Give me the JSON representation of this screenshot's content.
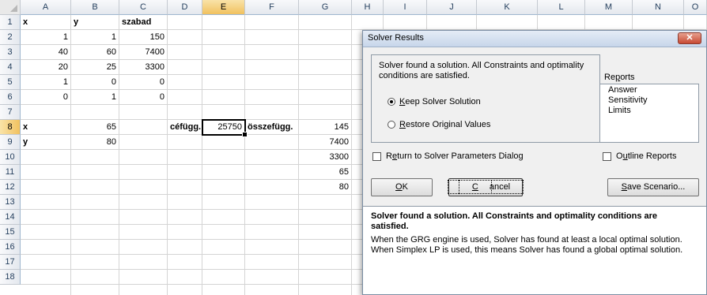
{
  "sheet": {
    "columns": [
      "A",
      "B",
      "C",
      "D",
      "E",
      "F",
      "G",
      "H",
      "I",
      "J",
      "K",
      "L",
      "M",
      "N",
      "O"
    ],
    "rows": [
      "1",
      "2",
      "3",
      "4",
      "5",
      "6",
      "7",
      "8",
      "9",
      "10",
      "11",
      "12",
      "13",
      "14",
      "15",
      "16",
      "17",
      "18"
    ],
    "selected_column": "E",
    "selected_row": "8",
    "cells": {
      "A1": "x",
      "B1": "y",
      "C1": "szabad",
      "A2": "1",
      "B2": "1",
      "C2": "150",
      "A3": "40",
      "B3": "60",
      "C3": "7400",
      "A4": "20",
      "B4": "25",
      "C4": "3300",
      "A5": "1",
      "B5": "0",
      "C5": "0",
      "A6": "0",
      "B6": "1",
      "C6": "0",
      "A8": "x",
      "B8": "65",
      "D8": "céfügg.",
      "E8": "25750",
      "F8": "összefügg.",
      "G8": "145",
      "A9": "y",
      "B9": "80",
      "G9": "7400",
      "G10": "3300",
      "G11": "65",
      "G12": "80"
    }
  },
  "dialog": {
    "title": "Solver Results",
    "message_top": "Solver found a solution.  All Constraints and optimality conditions are satisfied.",
    "option_keep": "Keep Solver Solution",
    "option_restore": "Restore Original Values",
    "option_selected": "keep",
    "reports_label": "Reports",
    "reports": [
      "Answer",
      "Sensitivity",
      "Limits"
    ],
    "return_label": "Return to Solver Parameters Dialog",
    "outline_label": "Outline Reports",
    "ok_label": "OK",
    "cancel_label": "Cancel",
    "save_label": "Save Scenario...",
    "info_bold": "Solver found a solution.  All Constraints and optimality conditions are satisfied.",
    "info_text": "When the GRG engine is used, Solver has found at least a local optimal solution. When Simplex LP is used, this means Solver has found a global optimal solution."
  }
}
